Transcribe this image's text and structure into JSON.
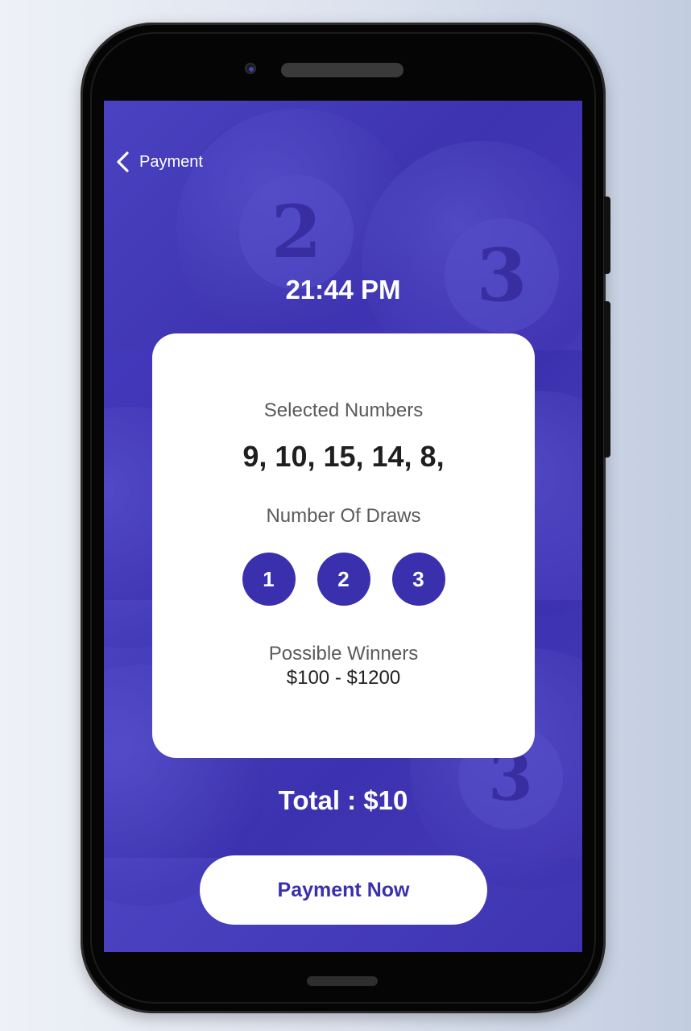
{
  "header": {
    "back_icon": "chevron-left-icon",
    "title": "Payment"
  },
  "time": "21:44 PM",
  "card": {
    "selected_label": "Selected Numbers",
    "selected_numbers": "9, 10, 15, 14, 8,",
    "draws_label": "Number Of Draws",
    "draws": [
      "1",
      "2",
      "3"
    ],
    "winners_label": "Possible Winners",
    "winners_range": "$100 - $1200"
  },
  "total": "Total : $10",
  "pay_button_label": "Payment Now",
  "background_ball_numbers": [
    "2",
    "3",
    "3"
  ],
  "colors": {
    "primary": "#3a30ad",
    "screen_background": "#3f35b3",
    "card": "#ffffff",
    "text_on_primary": "#ffffff"
  }
}
